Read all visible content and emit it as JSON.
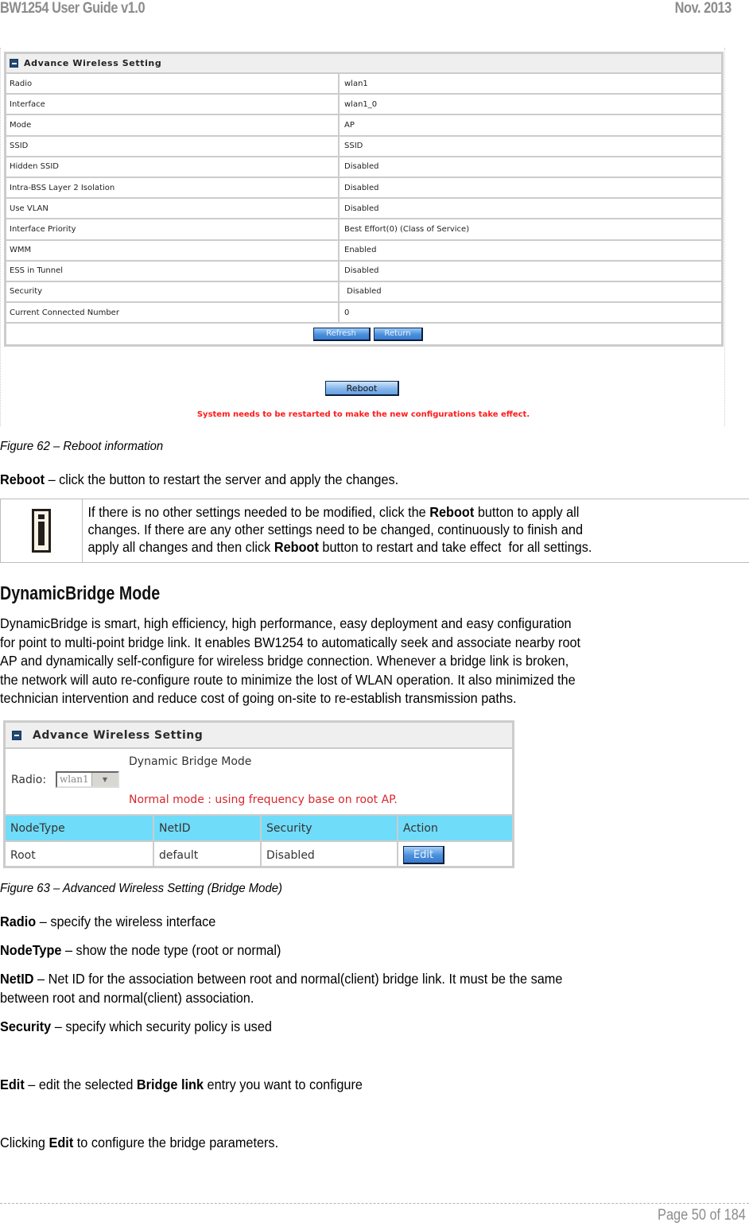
{
  "header": {
    "doc_title": "BW1254 User Guide v1.0",
    "date": "Nov.  2013"
  },
  "figure62": {
    "panel_title": "Advance Wireless Setting",
    "rows": [
      {
        "label": "Radio",
        "value": "wlan1"
      },
      {
        "label": "Interface",
        "value": "wlan1_0"
      },
      {
        "label": "Mode",
        "value": "AP"
      },
      {
        "label": "SSID",
        "value": "SSID"
      },
      {
        "label": "Hidden SSID",
        "value": "Disabled"
      },
      {
        "label": "Intra-BSS Layer 2 Isolation",
        "value": "Disabled"
      },
      {
        "label": "Use VLAN",
        "value": "Disabled"
      },
      {
        "label": "Interface Priority",
        "value": "Best Effort(0)  (Class of Service)"
      },
      {
        "label": "WMM",
        "value": "Enabled"
      },
      {
        "label": "ESS in Tunnel",
        "value": "Disabled"
      },
      {
        "label": "Security",
        "value": " Disabled"
      },
      {
        "label": "Current Connected Number",
        "value": "0"
      }
    ],
    "refresh_label": "Refresh",
    "return_label": "Return",
    "reboot_label": "Reboot",
    "restart_message": "System needs to be restarted to make the new configurations take effect.",
    "caption": "Figure 62 – Reboot information"
  },
  "reboot_desc": {
    "term": "Reboot",
    "text": " – click the button to restart the server and apply the changes."
  },
  "note": {
    "icon": "info-icon",
    "line1_a": "If there is no other settings needed to be modified, click the ",
    "line1_b": "Reboot",
    "line1_c": " button to apply all",
    "line2": "changes. If there are any other settings need to be changed, continuously to finish and",
    "line3_a": "apply all changes and then click ",
    "line3_b": "Reboot",
    "line3_c": " button to restart and take effect  for all settings."
  },
  "section": {
    "heading": "DynamicBridge Mode",
    "body_lines": [
      "DynamicBridge is smart, high efficiency, high performance, easy deployment and easy configuration",
      "for point to multi-point bridge link. It enables BW1254 to automatically seek and associate nearby root",
      "AP and dynamically self-configure for wireless bridge connection. Whenever a bridge link is broken,",
      "the network will auto re-configure route to minimize the lost of WLAN operation. It also minimized the",
      "technician intervention and reduce cost of going on-site to re-establish transmission paths."
    ]
  },
  "figure63": {
    "panel_title": "Advance Wireless Setting",
    "radio_label": "Radio:",
    "radio_value": "wlan1",
    "mode_label": "Dynamic Bridge Mode",
    "normal_message": "Normal mode : using frequency base on root AP.",
    "columns": [
      "NodeType",
      "NetID",
      "Security",
      "Action"
    ],
    "row": {
      "nodetype": "Root",
      "netid": "default",
      "security": "Disabled",
      "action_label": "Edit"
    },
    "caption": "Figure 63 – Advanced Wireless Setting (Bridge Mode)"
  },
  "definitions": [
    {
      "term": "Radio",
      "text": " – specify the wireless interface"
    },
    {
      "term": "NodeType",
      "text": " – show the node type (root or normal)"
    },
    {
      "term": "NetID",
      "text": " – Net ID for the association between root and normal(client) bridge link. It must be the same",
      "text2": "between root and normal(client) association."
    },
    {
      "term": "Security",
      "text": " – specify which security policy is used"
    }
  ],
  "edit_desc": {
    "term": "Edit",
    "text_a": " – edit the selected ",
    "term2": "Bridge link",
    "text_b": " entry you want to configure"
  },
  "clicking": {
    "text_a": "Clicking ",
    "term": "Edit",
    "text_b": " to configure the bridge parameters."
  },
  "footer": {
    "page": "Page 50 of 184"
  },
  "colors": {
    "header_gray": "#8c8c8c",
    "table_border": "#cccccc",
    "restart_red": "#ff1a1a",
    "bridge_header_cyan": "#6fdcf9",
    "normal_mode_red": "#d9262e",
    "button_blue": "#4a8fdc"
  }
}
